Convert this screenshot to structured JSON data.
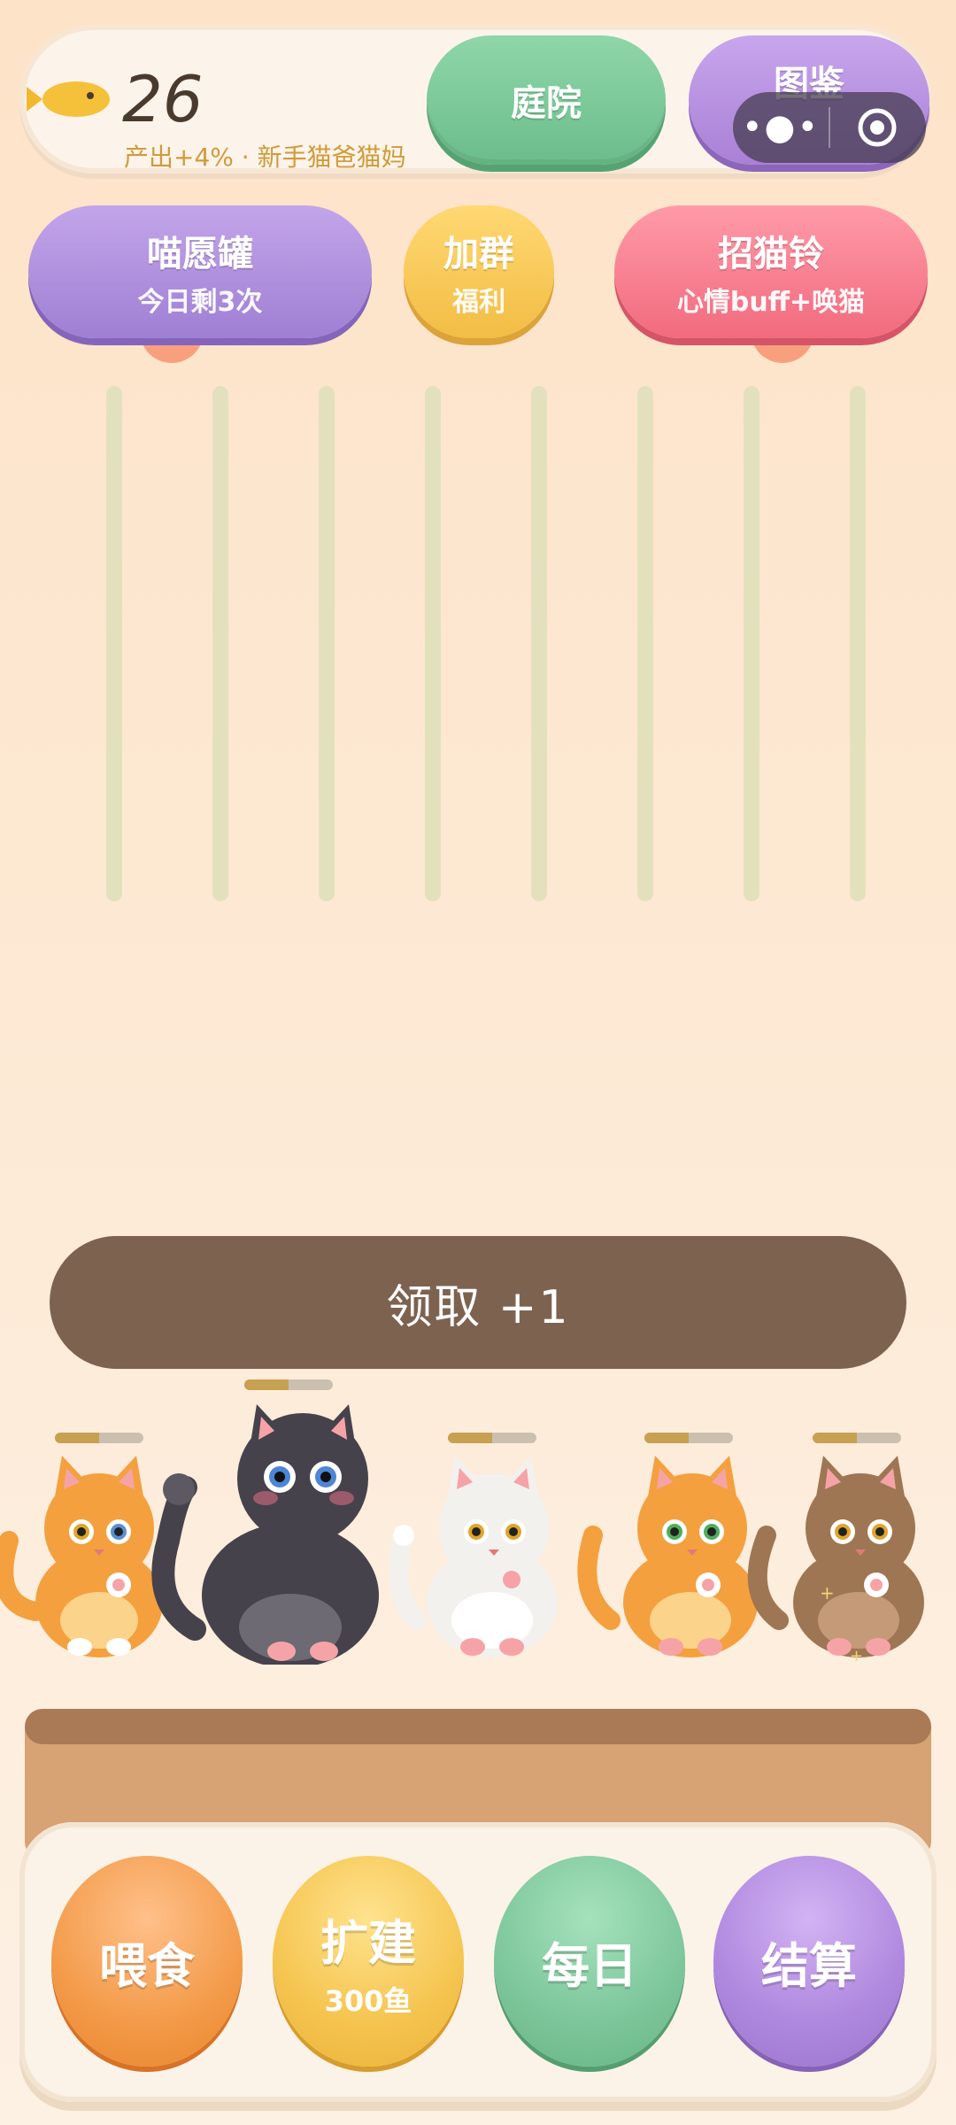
{
  "header": {
    "fish_count": "26",
    "output_text": "产出+4% · 新手猫爸猫妈",
    "courtyard_label": "庭院",
    "catalog_label": "图鉴"
  },
  "actions": {
    "wish_title": "喵愿罐",
    "wish_sub": "今日剩3次",
    "group_title": "加群",
    "group_sub": "福利",
    "bell_title": "招猫铃",
    "bell_sub": "心情buff+唤猫"
  },
  "claim": {
    "label": "领取 +1"
  },
  "cats": [
    {
      "color": "orange",
      "hp": 0.5
    },
    {
      "color": "black",
      "hp": 0.5
    },
    {
      "color": "white",
      "hp": 0.5
    },
    {
      "color": "orange",
      "hp": 0.5
    },
    {
      "color": "brown",
      "hp": 0.5
    }
  ],
  "bottom": {
    "feed_label": "喂食",
    "expand_label": "扩建",
    "expand_cost": "300鱼",
    "daily_label": "每日",
    "settle_label": "结算"
  },
  "colors": {
    "claim_bg": "#7e6250",
    "courtyard": "#7cc59a",
    "catalog": "#ae87de",
    "bell": "#f16b7e",
    "group": "#f5c44f"
  }
}
